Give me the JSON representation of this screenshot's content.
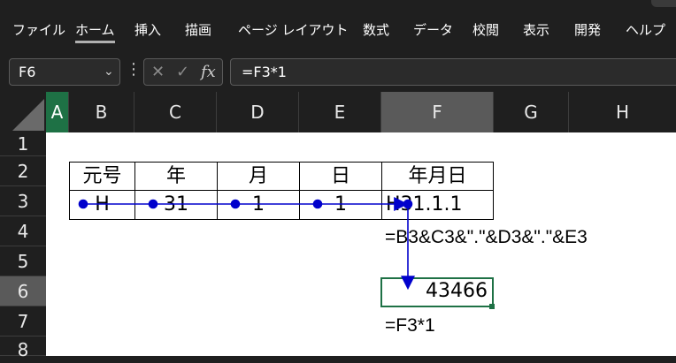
{
  "ribbon": {
    "tabs": [
      {
        "label": "ファイル"
      },
      {
        "label": "ホーム",
        "active": true
      },
      {
        "label": "挿入"
      },
      {
        "label": "描画"
      },
      {
        "label": "ページ レイアウト"
      },
      {
        "label": "数式"
      },
      {
        "label": "データ"
      },
      {
        "label": "校閲"
      },
      {
        "label": "表示"
      },
      {
        "label": "開発"
      },
      {
        "label": "ヘルプ"
      }
    ]
  },
  "formula_bar": {
    "name_box": "F6",
    "formula": "=F3*1",
    "fx_label": "fx"
  },
  "grid": {
    "columns": [
      "A",
      "B",
      "C",
      "D",
      "E",
      "F",
      "G",
      "H"
    ],
    "rows": [
      "1",
      "2",
      "3",
      "4",
      "5",
      "6",
      "7",
      "8"
    ],
    "selected_column": "F",
    "selected_row": "6"
  },
  "table": {
    "headers": [
      "元号",
      "年",
      "月",
      "日",
      "年月日"
    ],
    "row3": [
      "H",
      "31",
      "1",
      "1",
      "H31.1.1"
    ]
  },
  "notes": {
    "f4_formula": "=B3&C3&\".\"&D3&\".\"&E3",
    "f6_value": "43466",
    "f7_formula": "=F3*1"
  },
  "colors": {
    "accent": "#1e7145",
    "trace_arrow": "#0000cc",
    "sheet_bg": "#ffffff",
    "chrome_bg": "#1f1f1f"
  }
}
